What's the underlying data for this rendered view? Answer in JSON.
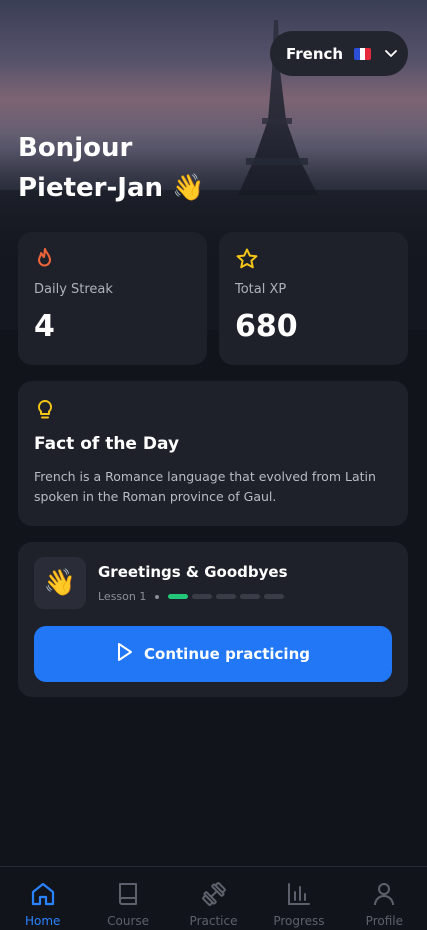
{
  "header": {
    "language": "French",
    "greeting_line1": "Bonjour",
    "greeting_line2": "Pieter-Jan 👋"
  },
  "stats": {
    "streak": {
      "label": "Daily Streak",
      "value": "4"
    },
    "xp": {
      "label": "Total XP",
      "value": "680"
    }
  },
  "fact": {
    "title": "Fact of the Day",
    "text": "French is a Romance language that evolved from Latin spoken in the Roman province of Gaul."
  },
  "lesson": {
    "emoji": "👋",
    "title": "Greetings & Goodbyes",
    "subtitle": "Lesson 1",
    "progress_steps_done": 1,
    "progress_steps_total": 5,
    "cta_label": "Continue practicing"
  },
  "tabs": [
    {
      "label": "Home",
      "icon": "home-icon",
      "active": true
    },
    {
      "label": "Course",
      "icon": "book-icon",
      "active": false
    },
    {
      "label": "Practice",
      "icon": "dumbbell-icon",
      "active": false
    },
    {
      "label": "Progress",
      "icon": "bar-chart-icon",
      "active": false
    },
    {
      "label": "Profile",
      "icon": "user-icon",
      "active": false
    }
  ],
  "colors": {
    "background": "#12141c",
    "card": "#1e212a",
    "accent": "#2177f5",
    "streak": "#f0643a",
    "xp": "#f5c518",
    "progress_done": "#22c77a"
  }
}
